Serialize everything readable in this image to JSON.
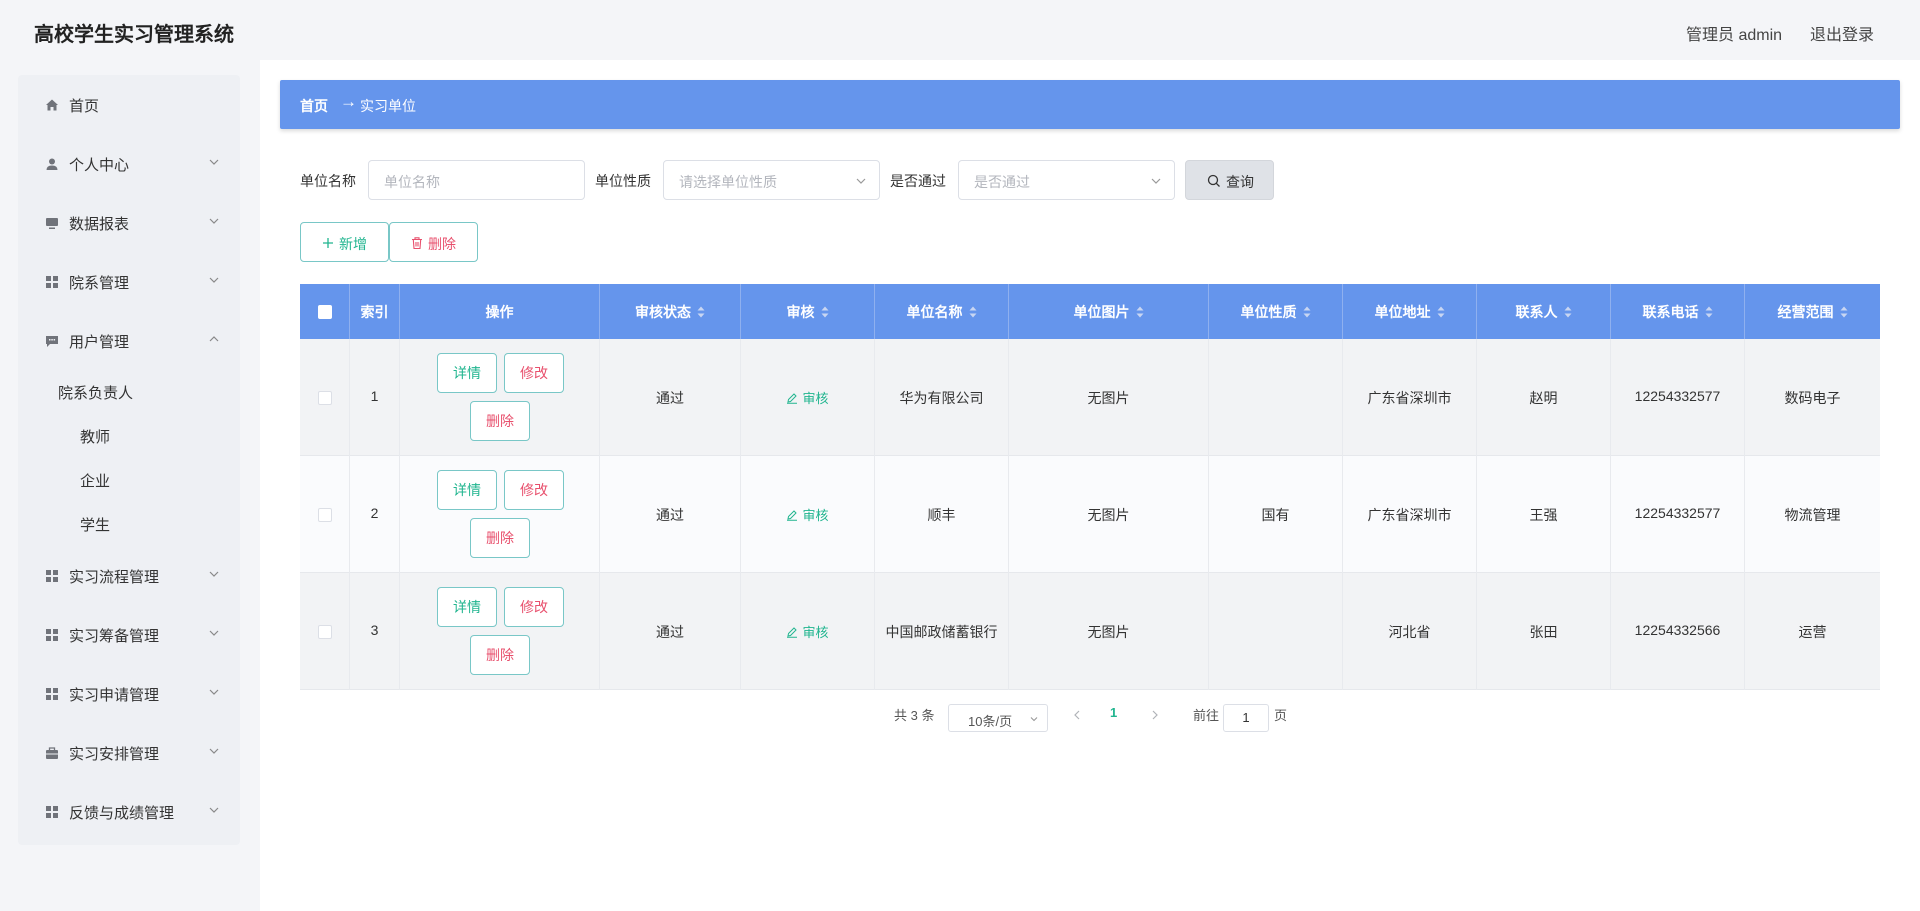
{
  "header": {
    "title": "高校学生实习管理系统",
    "user": "管理员 admin",
    "logout": "退出登录"
  },
  "sidebar": {
    "items": [
      {
        "label": "首页",
        "icon": "home-icon"
      },
      {
        "label": "个人中心",
        "icon": "user-icon"
      },
      {
        "label": "数据报表",
        "icon": "monitor-icon"
      },
      {
        "label": "院系管理",
        "icon": "grid-icon"
      },
      {
        "label": "用户管理",
        "icon": "chat-icon"
      },
      {
        "label": "实习流程管理",
        "icon": "grid-icon"
      },
      {
        "label": "实习筹备管理",
        "icon": "grid-icon"
      },
      {
        "label": "实习申请管理",
        "icon": "grid-icon"
      },
      {
        "label": "实习安排管理",
        "icon": "briefcase-icon"
      },
      {
        "label": "反馈与成绩管理",
        "icon": "grid-icon"
      }
    ],
    "subitems": [
      "院系负责人",
      "教师",
      "企业",
      "学生"
    ]
  },
  "breadcrumb": {
    "home": "首页",
    "current": "实习单位"
  },
  "filters": {
    "name_label": "单位名称",
    "name_placeholder": "单位名称",
    "type_label": "单位性质",
    "type_placeholder": "请选择单位性质",
    "pass_label": "是否通过",
    "pass_placeholder": "是否通过",
    "search": "查询"
  },
  "actions": {
    "add": "新增",
    "delete": "删除"
  },
  "table": {
    "columns": [
      "索引",
      "操作",
      "审核状态",
      "审核",
      "单位名称",
      "单位图片",
      "单位性质",
      "单位地址",
      "联系人",
      "联系电话",
      "经营范围"
    ],
    "row_buttons": {
      "detail": "详情",
      "edit": "修改",
      "delete": "删除",
      "audit": "审核"
    },
    "rows": [
      {
        "index": "1",
        "status": "通过",
        "name": "华为有限公司",
        "image": "无图片",
        "type": "",
        "address": "广东省深圳市",
        "contact": "赵明",
        "phone": "12254332577",
        "scope": "数码电子"
      },
      {
        "index": "2",
        "status": "通过",
        "name": "顺丰",
        "image": "无图片",
        "type": "国有",
        "address": "广东省深圳市",
        "contact": "王强",
        "phone": "12254332577",
        "scope": "物流管理"
      },
      {
        "index": "3",
        "status": "通过",
        "name": "中国邮政储蓄银行",
        "image": "无图片",
        "type": "",
        "address": "河北省",
        "contact": "张田",
        "phone": "12254332566",
        "scope": "运营"
      }
    ]
  },
  "pagination": {
    "total": "共 3 条",
    "page_size": "10条/页",
    "current_page": "1",
    "goto_prefix": "前往",
    "goto_value": "1",
    "goto_suffix": "页"
  },
  "colors": {
    "accent": "#6595ec",
    "teal": "#21b58f",
    "danger": "#e8506d"
  }
}
